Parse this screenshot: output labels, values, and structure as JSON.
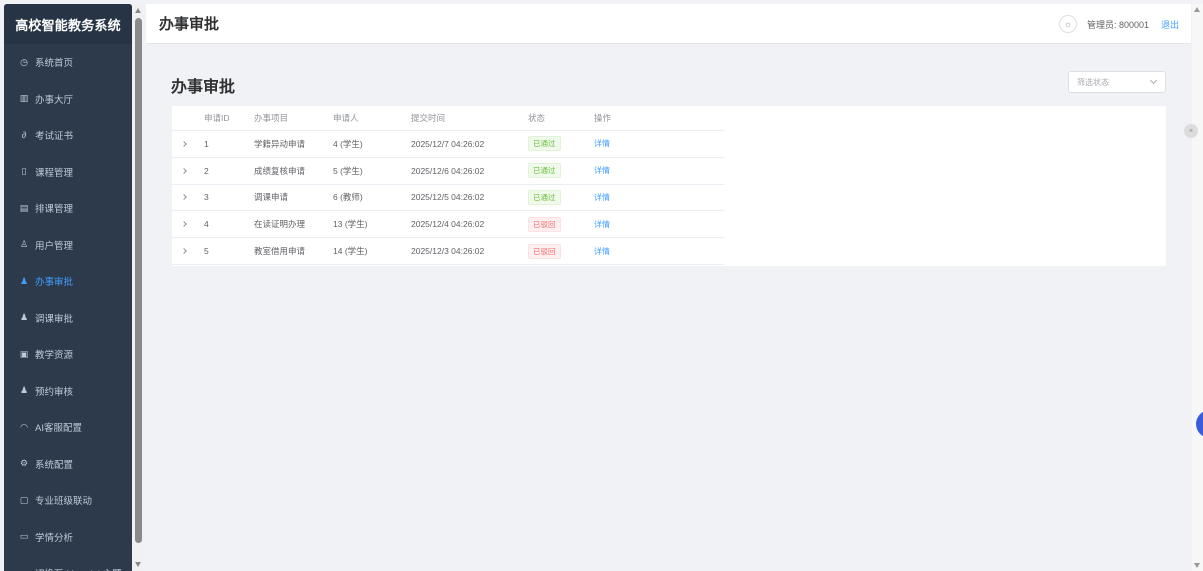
{
  "app": {
    "brand": "高校智能教务系统"
  },
  "sidebar": {
    "items": [
      {
        "label": "系统首页",
        "icon": "clock-icon",
        "glyph": "◷",
        "active": false
      },
      {
        "label": "办事大厅",
        "icon": "building-icon",
        "glyph": "▥",
        "active": false
      },
      {
        "label": "考试证书",
        "icon": "link-icon",
        "glyph": "∂",
        "active": false
      },
      {
        "label": "课程管理",
        "icon": "book-icon",
        "glyph": "▯",
        "active": false
      },
      {
        "label": "排课管理",
        "icon": "calendar-icon",
        "glyph": "▤",
        "active": false
      },
      {
        "label": "用户管理",
        "icon": "user-icon",
        "glyph": "♙",
        "active": false
      },
      {
        "label": "办事审批",
        "icon": "user-check-icon",
        "glyph": "♟",
        "active": true
      },
      {
        "label": "调课审批",
        "icon": "user-swap-icon",
        "glyph": "♟",
        "active": false
      },
      {
        "label": "教学资源",
        "icon": "folder-icon",
        "glyph": "▣",
        "active": false
      },
      {
        "label": "预约审核",
        "icon": "user-clock-icon",
        "glyph": "♟",
        "active": false
      },
      {
        "label": "AI客服配置",
        "icon": "headset-icon",
        "glyph": "◠",
        "active": false
      },
      {
        "label": "系统配置",
        "icon": "gear-icon",
        "glyph": "⚙",
        "active": false
      },
      {
        "label": "专业班级联动",
        "icon": "document-icon",
        "glyph": "▢",
        "active": false
      },
      {
        "label": "学情分析",
        "icon": "chart-icon",
        "glyph": "▭",
        "active": false
      },
      {
        "label": "切换至 Material 主题",
        "icon": "sun-icon",
        "glyph": "☼",
        "active": false
      }
    ]
  },
  "header": {
    "title": "办事审批",
    "admin_label": "管理员: 800001",
    "logout_label": "退出",
    "theme_icon": "sun-icon"
  },
  "main": {
    "title": "办事审批",
    "filter": {
      "placeholder": "筛选状态"
    },
    "table": {
      "columns": [
        "申请ID",
        "办事项目",
        "申请人",
        "提交时间",
        "状态",
        "操作"
      ],
      "rows": [
        {
          "id": "1",
          "item": "学籍异动申请",
          "applicant": "4 (学生)",
          "time": "2025/12/7 04:26:02",
          "status": "已通过",
          "status_kind": "ok",
          "action": "详情"
        },
        {
          "id": "2",
          "item": "成绩复核申请",
          "applicant": "5 (学生)",
          "time": "2025/12/6 04:26:02",
          "status": "已通过",
          "status_kind": "ok",
          "action": "详情"
        },
        {
          "id": "3",
          "item": "调课申请",
          "applicant": "6 (教师)",
          "time": "2025/12/5 04:26:02",
          "status": "已通过",
          "status_kind": "ok",
          "action": "详情"
        },
        {
          "id": "4",
          "item": "在读证明办理",
          "applicant": "13 (学生)",
          "time": "2025/12/4 04:26:02",
          "status": "已驳回",
          "status_kind": "bad",
          "action": "详情"
        },
        {
          "id": "5",
          "item": "教室借用申请",
          "applicant": "14 (学生)",
          "time": "2025/12/3 04:26:02",
          "status": "已驳回",
          "status_kind": "bad",
          "action": "详情"
        }
      ]
    }
  },
  "colors": {
    "sidebar_bg": "#2d3a4b",
    "accent": "#409eff",
    "status_ok": "#67c23a",
    "status_bad": "#f56c6c"
  }
}
